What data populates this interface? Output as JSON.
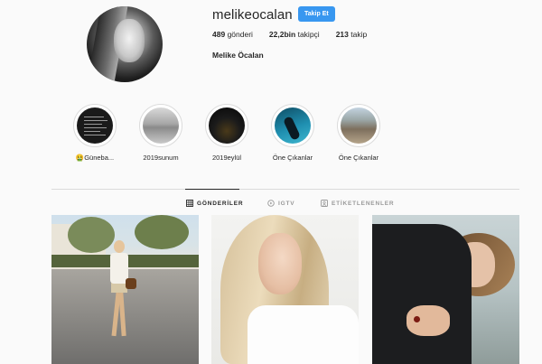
{
  "profile": {
    "username": "melikeocalan",
    "follow_label": "Takip Et",
    "full_name": "Melike Öcalan",
    "stats": [
      {
        "value": "489",
        "label": "gönderi"
      },
      {
        "value": "22,2bin",
        "label": "takipçi"
      },
      {
        "value": "213",
        "label": "takip"
      }
    ]
  },
  "highlights": [
    {
      "label": "🤮Güneba..."
    },
    {
      "label": "2019sunum"
    },
    {
      "label": "2019eylül"
    },
    {
      "label": "Öne Çıkanlar"
    },
    {
      "label": "Öne Çıkanlar"
    }
  ],
  "tabs": [
    {
      "label": "GÖNDERİLER",
      "icon": "grid-icon",
      "active": true
    },
    {
      "label": "IGTV",
      "icon": "igtv-icon",
      "active": false
    },
    {
      "label": "ETİKETLENENLER",
      "icon": "tagged-icon",
      "active": false
    }
  ],
  "colors": {
    "accent": "#3897f0",
    "background": "#fafafa",
    "text": "#262626",
    "muted": "#999999",
    "border": "#dbdbdb"
  }
}
